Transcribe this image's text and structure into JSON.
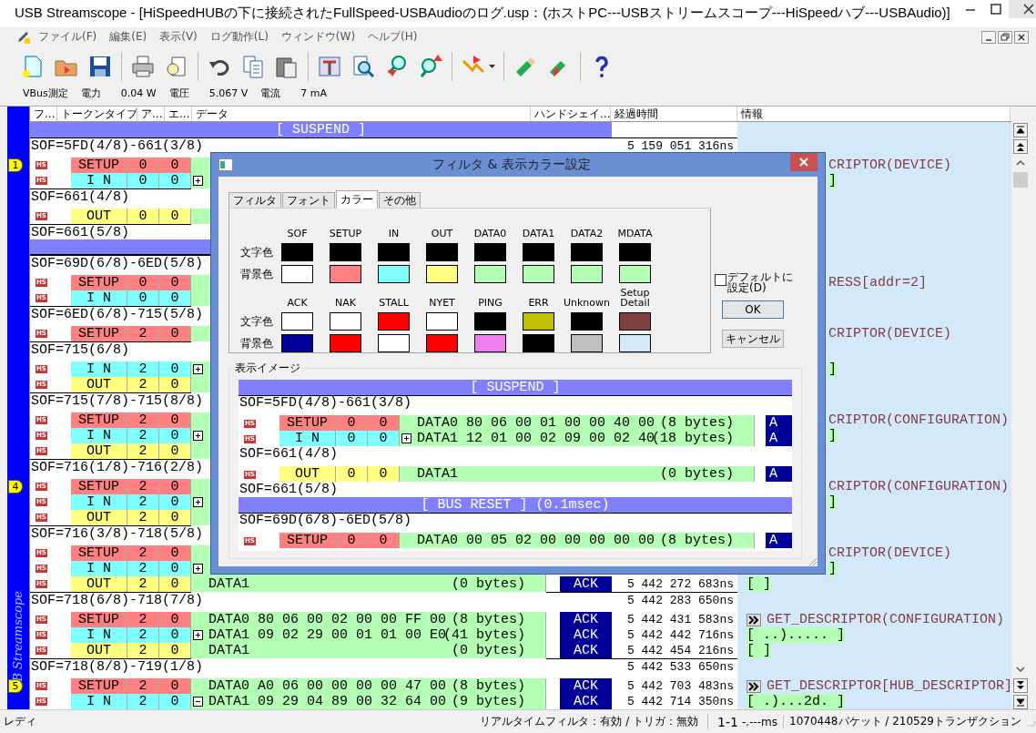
{
  "window": {
    "title": "USB Streamscope - [HiSpeedHUBの下に接続されたFullSpeed-USBAudioのログ.usp：(ホストPC---USBストリームスコープ---HiSpeedハブ---USBAudio)]"
  },
  "menu": [
    "ファイル(F)",
    "編集(E)",
    "表示(V)",
    "ログ動作(L)",
    "ウィンドウ(W)",
    "ヘルプ(H)"
  ],
  "vbus": {
    "label": "VBus測定",
    "power_label": "電力",
    "power": "0.04 W",
    "voltage_label": "電圧",
    "voltage": "5.067 V",
    "current_label": "電流",
    "current": "7 mA"
  },
  "columns": [
    "フ...",
    "トークンタイプ",
    "ア...",
    "エ...",
    "データ",
    "ハンドシェイ...",
    "経過時間",
    "情報"
  ],
  "side_label": "B Streamscope",
  "log": [
    {
      "kind": "bar",
      "text": "[ SUSPEND ]"
    },
    {
      "kind": "sof",
      "text": "SOF=5FD(4/8)-661(3/8)",
      "time": "5 159 051 316ns"
    },
    {
      "kind": "packet",
      "marker": "1",
      "speed": "HS",
      "token": {
        "text": "SETUP",
        "kind": "setup"
      },
      "addr": "0",
      "endp": "0",
      "info": {
        "kind": "command_cut",
        "text": "CRIPTOR(DEVICE)"
      }
    },
    {
      "kind": "packet",
      "speed": "HS",
      "token": {
        "text": "I N",
        "kind": "in"
      },
      "addr": "0",
      "endp": "0",
      "expanded": false,
      "info": {
        "kind": "hex_cut",
        "text": " ]"
      }
    },
    {
      "kind": "sof",
      "text": "SOF=661(4/8)"
    },
    {
      "kind": "packet",
      "speed": "HS",
      "token": {
        "text": "OUT",
        "kind": "out"
      },
      "addr": "0",
      "endp": "0"
    },
    {
      "kind": "sof",
      "text": "SOF=661(5/8)"
    },
    {
      "kind": "bar"
    },
    {
      "kind": "sof",
      "text": "SOF=69D(6/8)-6ED(5/8)"
    },
    {
      "kind": "packet",
      "speed": "HS",
      "token": {
        "text": "SETUP",
        "kind": "setup"
      },
      "addr": "0",
      "endp": "0",
      "info": {
        "kind": "command_cut",
        "text": "RESS[addr=2]"
      }
    },
    {
      "kind": "packet",
      "speed": "HS",
      "token": {
        "text": "I N",
        "kind": "in"
      },
      "addr": "0",
      "endp": "0"
    },
    {
      "kind": "sof",
      "text": "SOF=6ED(6/8)-715(5/8)"
    },
    {
      "kind": "packet",
      "speed": "HS",
      "token": {
        "text": "SETUP",
        "kind": "setup"
      },
      "addr": "2",
      "endp": "0",
      "info": {
        "kind": "command_cut",
        "text": "CRIPTOR(DEVICE)"
      }
    },
    {
      "kind": "sof",
      "text": "SOF=715(6/8)"
    },
    {
      "kind": "packet",
      "speed": "HS",
      "token": {
        "text": "I N",
        "kind": "in"
      },
      "addr": "2",
      "endp": "0",
      "expanded": false,
      "info": {
        "kind": "hex_cut",
        "text": " ]"
      }
    },
    {
      "kind": "packet",
      "speed": "HS",
      "token": {
        "text": "OUT",
        "kind": "out"
      },
      "addr": "2",
      "endp": "0"
    },
    {
      "kind": "sof",
      "text": "SOF=715(7/8)-715(8/8)"
    },
    {
      "kind": "packet",
      "speed": "HS",
      "token": {
        "text": "SETUP",
        "kind": "setup"
      },
      "addr": "2",
      "endp": "0",
      "info": {
        "kind": "command_cut",
        "text": "CRIPTOR(CONFIGURATION)"
      }
    },
    {
      "kind": "packet",
      "speed": "HS",
      "token": {
        "text": "I N",
        "kind": "in"
      },
      "addr": "2",
      "endp": "0",
      "expanded": false,
      "info": {
        "kind": "hex_cut",
        "text": " ]"
      }
    },
    {
      "kind": "packet",
      "speed": "HS",
      "token": {
        "text": "OUT",
        "kind": "out"
      },
      "addr": "2",
      "endp": "0"
    },
    {
      "kind": "sof",
      "text": "SOF=716(1/8)-716(2/8)"
    },
    {
      "kind": "packet",
      "marker": "4",
      "speed": "HS",
      "token": {
        "text": "SETUP",
        "kind": "setup"
      },
      "addr": "2",
      "endp": "0",
      "info": {
        "kind": "command_cut",
        "text": "CRIPTOR(CONFIGURATION)"
      }
    },
    {
      "kind": "packet",
      "speed": "HS",
      "token": {
        "text": "I N",
        "kind": "in"
      },
      "addr": "2",
      "endp": "0",
      "expanded": false,
      "info": {
        "kind": "hex_cut",
        "text": " ]"
      }
    },
    {
      "kind": "packet",
      "speed": "HS",
      "token": {
        "text": "OUT",
        "kind": "out"
      },
      "addr": "2",
      "endp": "0"
    },
    {
      "kind": "sof",
      "text": "SOF=716(3/8)-718(5/8)"
    },
    {
      "kind": "packet",
      "speed": "HS",
      "token": {
        "text": "SETUP",
        "kind": "setup"
      },
      "addr": "2",
      "endp": "0",
      "info": {
        "kind": "command_cut",
        "text": "CRIPTOR(DEVICE)"
      }
    },
    {
      "kind": "packet",
      "speed": "HS",
      "token": {
        "text": "I N",
        "kind": "in"
      },
      "addr": "2",
      "endp": "0",
      "expanded": false,
      "info": {
        "kind": "hex_cut",
        "text": " ]"
      }
    },
    {
      "kind": "packet",
      "speed": "HS",
      "token": {
        "text": "OUT",
        "kind": "out"
      },
      "addr": "2",
      "endp": "0",
      "data": "DATA1",
      "size": "(0 bytes)",
      "handshake": "ACK",
      "time": "5 442 272 683ns",
      "info": {
        "kind": "hex",
        "text": "[  ]"
      }
    },
    {
      "kind": "sof",
      "text": "SOF=718(6/8)-718(7/8)",
      "time": "5 442 283 650ns"
    },
    {
      "kind": "packet",
      "speed": "HS",
      "token": {
        "text": "SETUP",
        "kind": "setup"
      },
      "addr": "2",
      "endp": "0",
      "data": "DATA0 80 06 00 02 00 00 FF 00",
      "size": "(8 bytes)",
      "handshake": "ACK",
      "time": "5 442 431 583ns",
      "info": {
        "kind": "command",
        "text": "GET_DESCRIPTOR(CONFIGURATION)"
      }
    },
    {
      "kind": "packet",
      "speed": "HS",
      "token": {
        "text": "I N",
        "kind": "in"
      },
      "addr": "2",
      "endp": "0",
      "expanded": false,
      "data": "DATA1 09 02 29 00 01 01 00 E0",
      "size": "(41 bytes)",
      "handshake": "ACK",
      "time": "5 442 442 716ns",
      "info": {
        "kind": "hex",
        "text": "[ ..)..... ]"
      }
    },
    {
      "kind": "packet",
      "speed": "HS",
      "token": {
        "text": "OUT",
        "kind": "out"
      },
      "addr": "2",
      "endp": "0",
      "data": "DATA1",
      "size": "(0 bytes)",
      "handshake": "ACK",
      "time": "5 442 454 216ns",
      "info": {
        "kind": "hex",
        "text": "[  ]"
      }
    },
    {
      "kind": "sof",
      "text": "SOF=718(8/8)-719(1/8)",
      "time": "5 442 533 650ns"
    },
    {
      "kind": "packet",
      "marker": "5",
      "speed": "HS",
      "token": {
        "text": "SETUP",
        "kind": "setup"
      },
      "addr": "2",
      "endp": "0",
      "data": "DATA0 A0 06 00 00 00 00 47 00",
      "size": "(8 bytes)",
      "handshake": "ACK",
      "time": "5 442 703 483ns",
      "info": {
        "kind": "command",
        "text": "GET_DESCRIPTOR[HUB_DESCRIPTOR]"
      }
    },
    {
      "kind": "packet",
      "speed": "HS",
      "token": {
        "text": "I N",
        "kind": "in"
      },
      "addr": "2",
      "endp": "0",
      "expanded": true,
      "data": "DATA1 09 29 04 89 00 32 64 00",
      "size": "(9 bytes)",
      "handshake": "ACK",
      "time": "5 442 714 350ns",
      "info": {
        "kind": "hex",
        "text": "[ .)...2d. ]"
      }
    }
  ],
  "dialog": {
    "title": "フィルタ & 表示カラー設定",
    "tabs": [
      {
        "label": "フィルタ",
        "selected": false
      },
      {
        "label": "フォント",
        "selected": false
      },
      {
        "label": "カラー",
        "selected": true
      },
      {
        "label": "その他",
        "selected": false
      }
    ],
    "color_groups": [
      {
        "row_labels": [
          "文字色",
          "背景色"
        ],
        "items": [
          {
            "label": "SOF",
            "colors": [
              {
                "color": "#000000"
              },
              {
                "color": "#ffffff"
              }
            ]
          },
          {
            "label": "SETUP",
            "colors": [
              {
                "color": "#000000"
              },
              {
                "color": "#ff8080"
              }
            ]
          },
          {
            "label": "IN",
            "colors": [
              {
                "color": "#000000"
              },
              {
                "color": "#80ffff"
              }
            ]
          },
          {
            "label": "OUT",
            "colors": [
              {
                "color": "#000000"
              },
              {
                "color": "#ffff80"
              }
            ]
          },
          {
            "label": "DATA0",
            "colors": [
              {
                "color": "#000000"
              },
              {
                "color": "#b3ffb3"
              }
            ]
          },
          {
            "label": "DATA1",
            "colors": [
              {
                "color": "#000000"
              },
              {
                "color": "#b3ffb3"
              }
            ]
          },
          {
            "label": "DATA2",
            "colors": [
              {
                "color": "#000000"
              },
              {
                "color": "#b3ffb3"
              }
            ]
          },
          {
            "label": "MDATA",
            "colors": [
              {
                "color": "#000000"
              },
              {
                "color": "#b3ffb3"
              }
            ]
          }
        ]
      },
      {
        "row_labels": [
          "文字色",
          "背景色"
        ],
        "items": [
          {
            "label": "ACK",
            "colors": [
              {
                "color": "#ffffff"
              },
              {
                "color": "#000099"
              }
            ]
          },
          {
            "label": "NAK",
            "colors": [
              {
                "color": "#ffffff"
              },
              {
                "color": "#ff0000"
              }
            ]
          },
          {
            "label": "STALL",
            "colors": [
              {
                "color": "#ff0000"
              },
              {
                "color": "#ffffff"
              }
            ]
          },
          {
            "label": "NYET",
            "colors": [
              {
                "color": "#ffffff"
              },
              {
                "color": "#ff0000"
              }
            ]
          },
          {
            "label": "PING",
            "colors": [
              {
                "color": "#000000"
              },
              {
                "color": "#f080f0"
              }
            ]
          },
          {
            "label": "ERR",
            "colors": [
              {
                "color": "#c0c000"
              },
              {
                "color": "#000000"
              }
            ]
          },
          {
            "label": "Unknown",
            "colors": [
              {
                "color": "#000000"
              },
              {
                "color": "#c0c0c0"
              }
            ]
          },
          {
            "label": "Setup Detail",
            "colors": [
              {
                "color": "#804040"
              },
              {
                "color": "#d4e8fc"
              }
            ]
          }
        ]
      }
    ],
    "default_checkbox": {
      "label": "デフォルトに設定(D)",
      "checked": false
    },
    "ok": "OK",
    "cancel": "キャンセル",
    "preview": {
      "title": "表示イメージ",
      "rows": [
        {
          "kind": "bar",
          "text": "[ SUSPEND ]"
        },
        {
          "kind": "sof",
          "text": "SOF=5FD(4/8)-661(3/8)"
        },
        {
          "kind": "packet",
          "speed": "HS",
          "token": {
            "text": "SETUP",
            "kind": "setup"
          },
          "addr": "0",
          "endp": "0",
          "data": "DATA0 80 06 00 01 00 00 40 00",
          "size": "(8 bytes)",
          "handshake": "A"
        },
        {
          "kind": "packet",
          "speed": "HS",
          "token": {
            "text": "I N",
            "kind": "in"
          },
          "addr": "0",
          "endp": "0",
          "expanded": false,
          "data": "DATA1 12 01 00 02 09 00 02 40",
          "size": "(18 bytes)",
          "handshake": "A"
        },
        {
          "kind": "sof",
          "text": "SOF=661(4/8)"
        },
        {
          "kind": "packet",
          "speed": "HS",
          "token": {
            "text": "OUT",
            "kind": "out"
          },
          "addr": "0",
          "endp": "0",
          "data": "DATA1",
          "size": "(0 bytes)",
          "handshake": "A"
        },
        {
          "kind": "sof",
          "text": "SOF=661(5/8)"
        },
        {
          "kind": "bar",
          "text": "[ BUS RESET ]  (0.1msec)"
        },
        {
          "kind": "sof",
          "text": "SOF=69D(6/8)-6ED(5/8)"
        },
        {
          "kind": "packet",
          "speed": "HS",
          "token": {
            "text": "SETUP",
            "kind": "setup"
          },
          "addr": "0",
          "endp": "0",
          "data": "DATA0 00 05 02 00 00 00 00 00",
          "size": "(8 bytes)",
          "handshake": "A"
        }
      ]
    }
  },
  "status_bar": {
    "state": "レディ",
    "filter": "リアルタイムフィルタ：有効 / トリガ：無効",
    "position": "1-1",
    "duration": "-.---ms",
    "counts": "1070448パケット / 210529トランザクション"
  }
}
